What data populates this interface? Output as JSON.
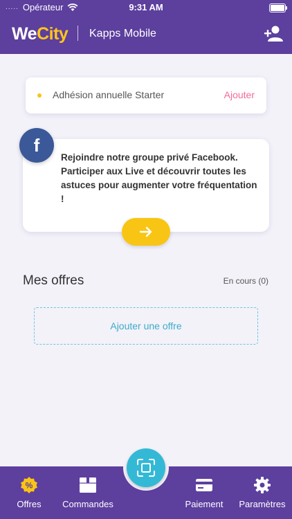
{
  "status_bar": {
    "carrier": "Opérateur",
    "time": "9:31 AM",
    "signal_dots": "....."
  },
  "header": {
    "logo_we": "We",
    "logo_city": "City",
    "title": "Kapps Mobile",
    "icon": "add-user-icon"
  },
  "membership": {
    "label": "Adhésion annuelle Starter",
    "action": "Ajouter"
  },
  "facebook_card": {
    "icon_letter": "f",
    "text": "Rejoindre notre groupe privé Facebook. Participer aux Live et découvrir toutes les astuces pour augmenter votre fréquentation !",
    "button_icon": "arrow-right-icon"
  },
  "offers": {
    "title": "Mes offres",
    "count": "En cours (0)",
    "add_label": "Ajouter une offre"
  },
  "tabs": [
    {
      "label": "Offres",
      "icon": "percent-badge-icon"
    },
    {
      "label": "Commandes",
      "icon": "box-icon"
    },
    {
      "label": "Paiement",
      "icon": "credit-card-icon"
    },
    {
      "label": "Paramètres",
      "icon": "gear-icon"
    }
  ],
  "scan_button": {
    "icon": "scan-icon"
  },
  "colors": {
    "primary": "#5d3f9e",
    "accent_yellow": "#f9c514",
    "pink": "#f26b96",
    "teal": "#33b9d6",
    "facebook": "#3b5998"
  }
}
